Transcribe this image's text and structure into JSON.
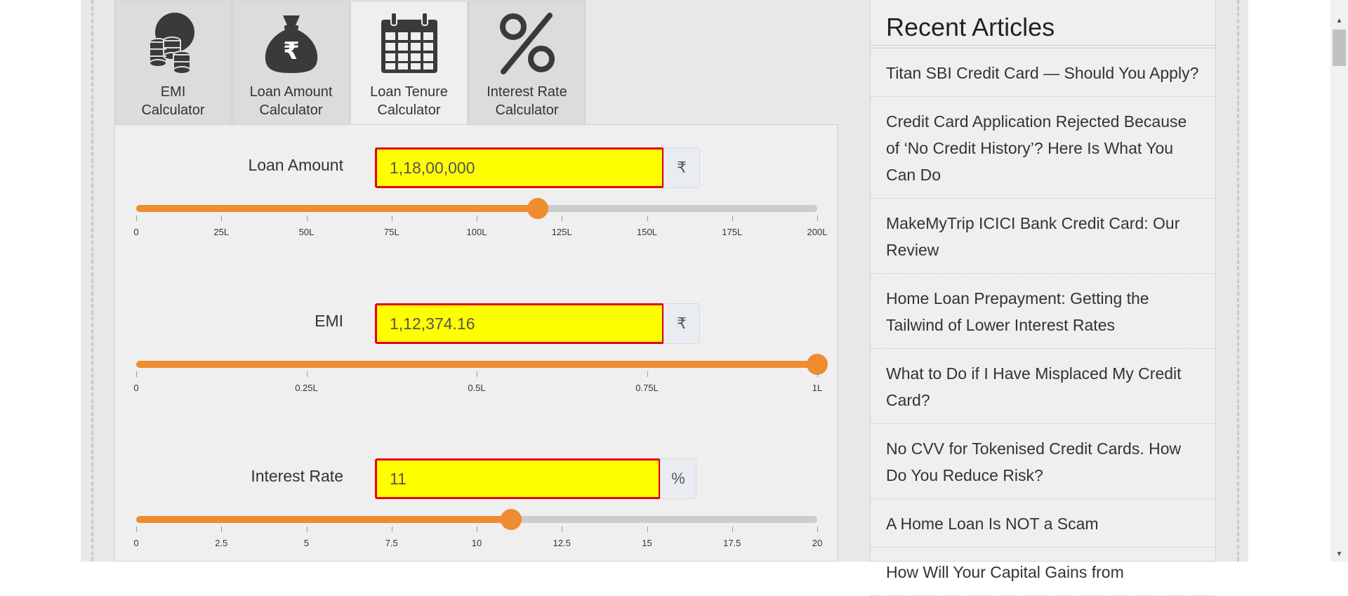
{
  "tabs": [
    {
      "label_line1": "EMI",
      "label_line2": "Calculator",
      "icon": "coins-icon",
      "active": false
    },
    {
      "label_line1": "Loan Amount",
      "label_line2": "Calculator",
      "icon": "money-bag-rupee-icon",
      "active": false
    },
    {
      "label_line1": "Loan Tenure",
      "label_line2": "Calculator",
      "icon": "calendar-icon",
      "active": true
    },
    {
      "label_line1": "Interest Rate",
      "label_line2": "Calculator",
      "icon": "percent-icon",
      "active": false
    }
  ],
  "loan_amount": {
    "label": "Loan Amount",
    "value": "1,18,00,000",
    "unit": "₹",
    "slider_value_L": 118,
    "slider_max_L": 200,
    "ticks": [
      "0",
      "25L",
      "50L",
      "75L",
      "100L",
      "125L",
      "150L",
      "175L",
      "200L"
    ]
  },
  "emi": {
    "label": "EMI",
    "value": "1,12,374.16",
    "unit": "₹",
    "slider_fraction": 1.0,
    "ticks": [
      "0",
      "0.25L",
      "0.5L",
      "0.75L",
      "1L"
    ]
  },
  "interest_rate": {
    "label": "Interest Rate",
    "value": "11",
    "unit": "%",
    "slider_value": 11,
    "slider_max": 20,
    "ticks": [
      "0",
      "2.5",
      "5",
      "7.5",
      "10",
      "12.5",
      "15",
      "17.5",
      "20"
    ]
  },
  "sidebar": {
    "title": "Recent Articles",
    "articles": [
      "Titan SBI Credit Card — Should You Apply?",
      "Credit Card Application Rejected Because of ‘No Credit History’? Here Is What You Can Do",
      "MakeMyTrip ICICI Bank Credit Card: Our Review",
      "Home Loan Prepayment: Getting the Tailwind of Lower Interest Rates",
      "What to Do if I Have Misplaced My Credit Card?",
      "No CVV for Tokenised Credit Cards. How Do You Reduce Risk?",
      "A Home Loan Is NOT a Scam",
      "How Will Your Capital Gains from"
    ]
  },
  "colors": {
    "accent": "#ee8c2f",
    "field_bg": "#ffff00",
    "field_border": "#e3001b",
    "icon": "#3a3a3a"
  }
}
